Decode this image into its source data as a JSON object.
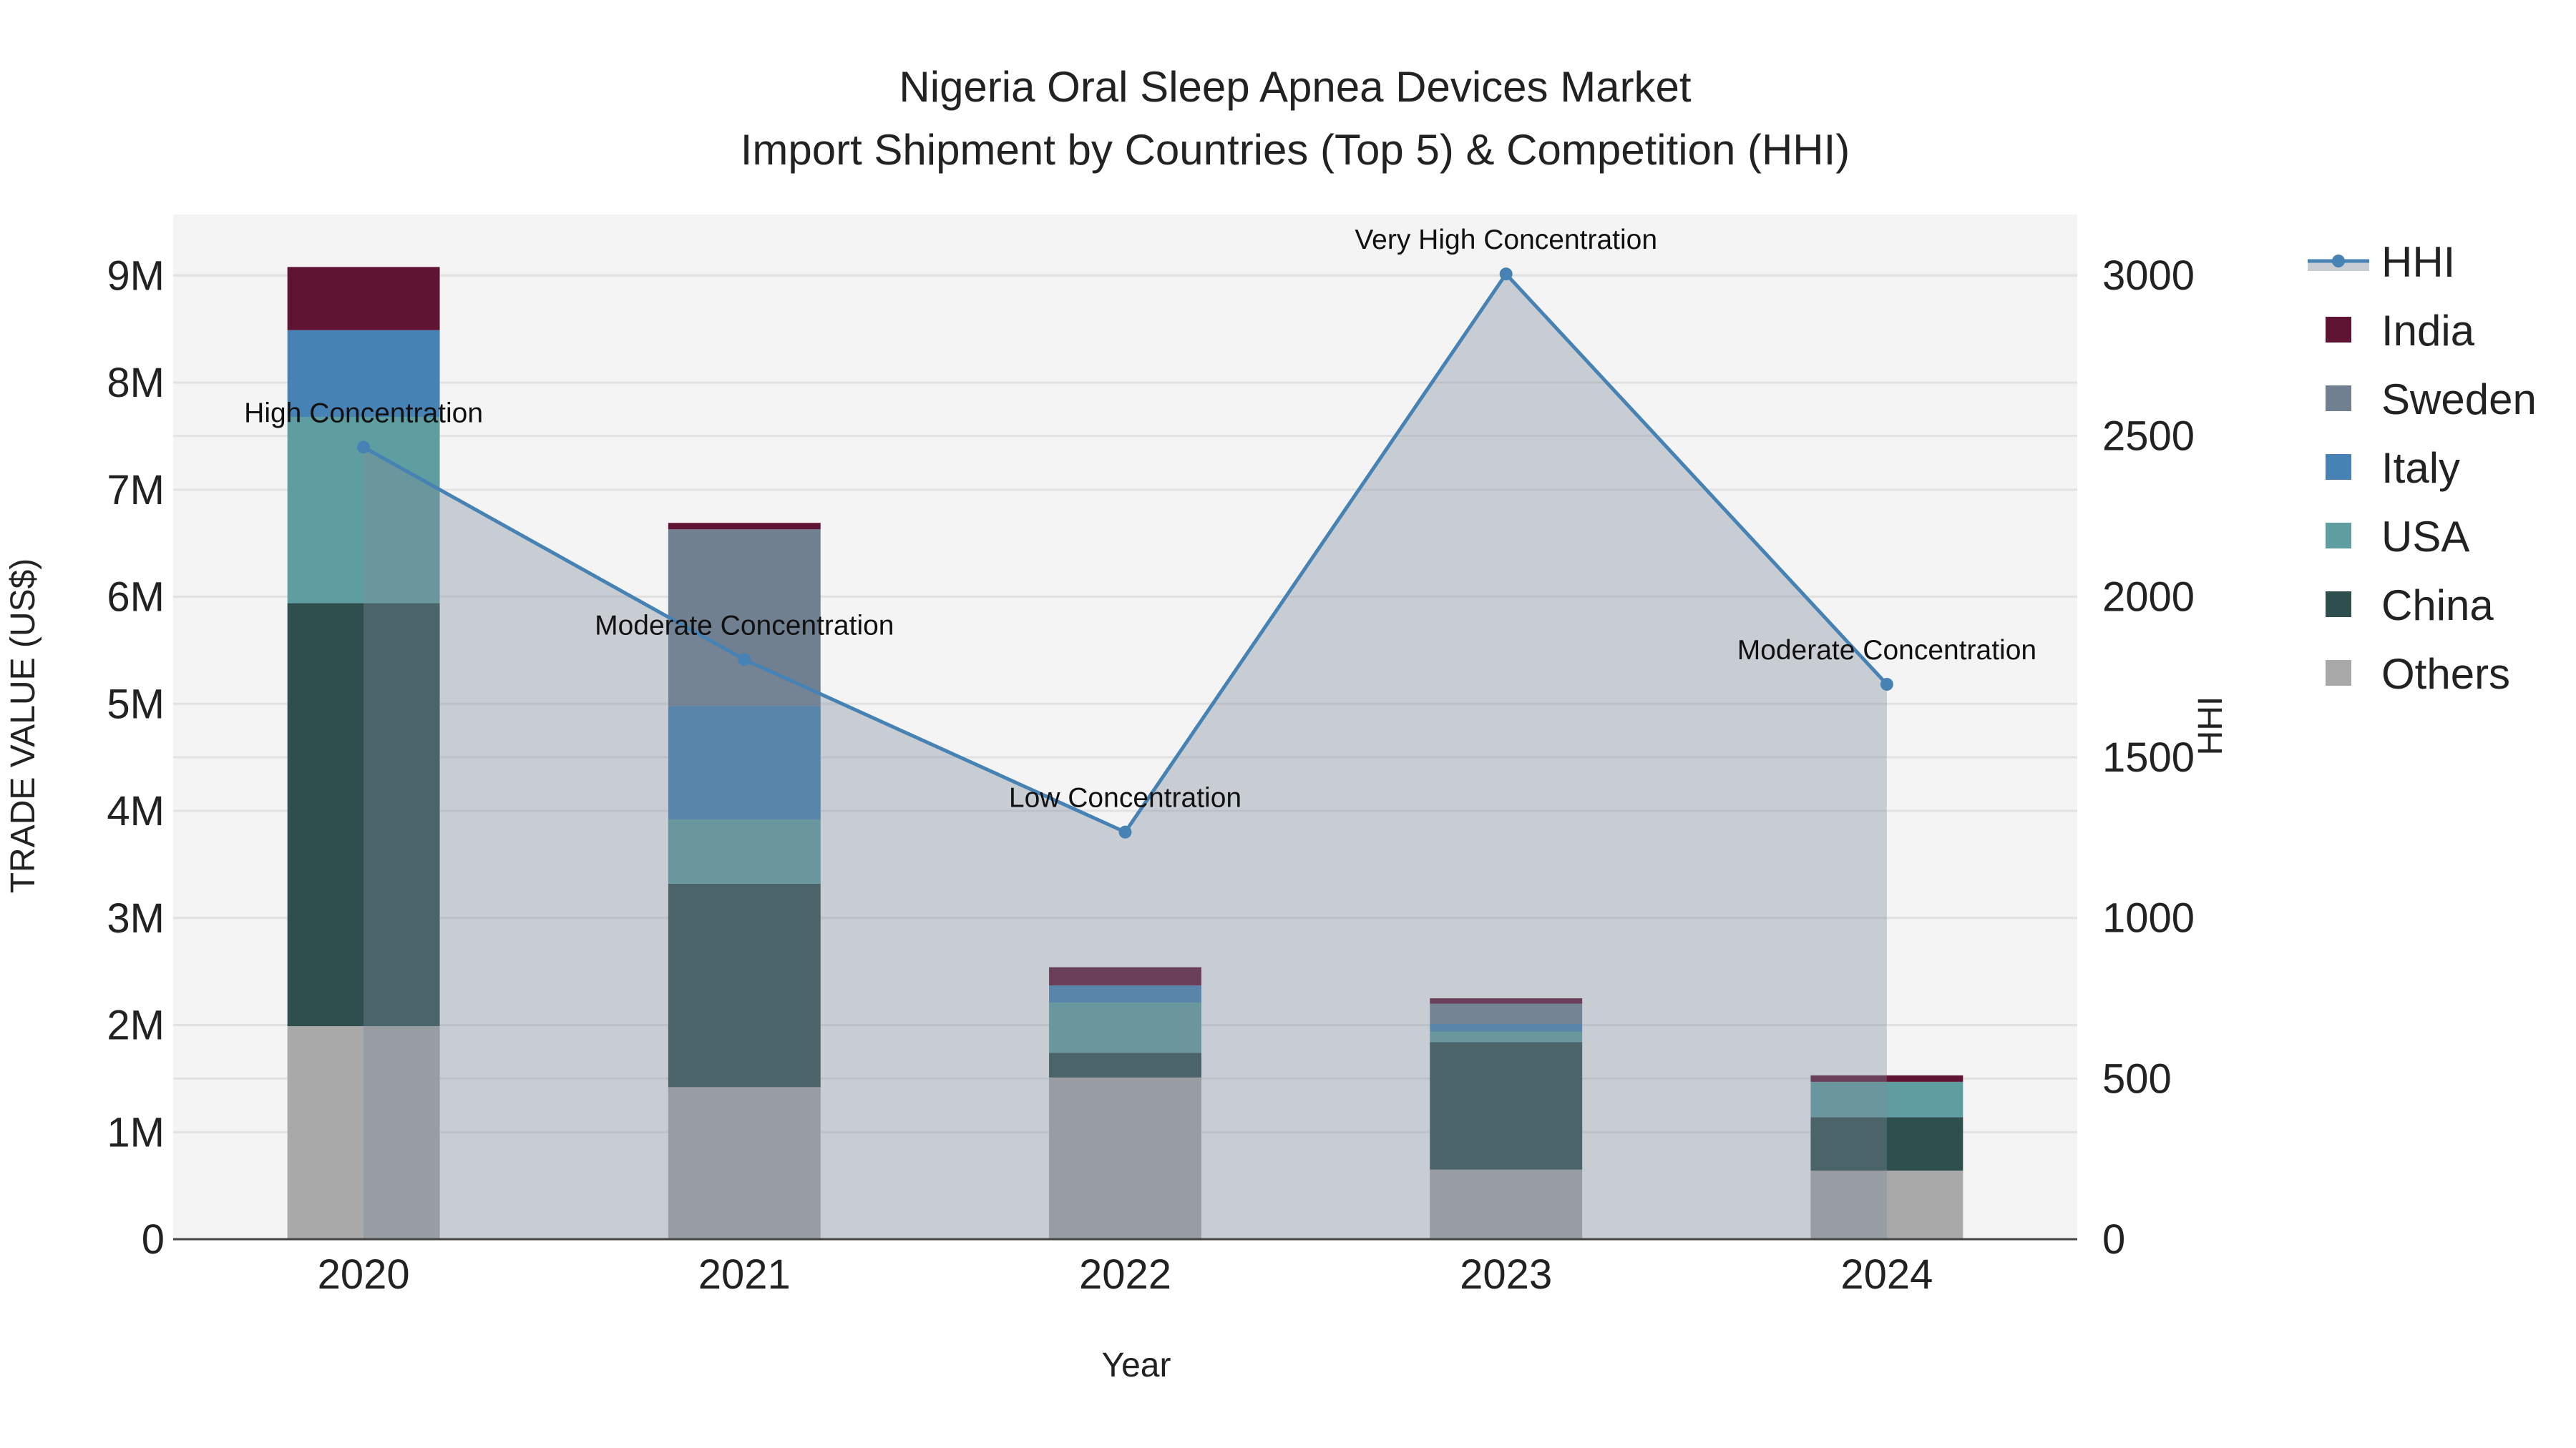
{
  "chart_data": {
    "type": "bar",
    "title": "Nigeria Oral Sleep Apnea Devices Market",
    "subtitle": "Import Shipment by Countries (Top 5) & Competition (HHI)",
    "xlabel": "Year",
    "ylabel": "TRADE VALUE (US$)",
    "y2label": "HHI",
    "categories": [
      "2020",
      "2021",
      "2022",
      "2023",
      "2024"
    ],
    "ylim": [
      0,
      9570000
    ],
    "y2lim": [
      0,
      3189
    ],
    "yticks": [
      0,
      1000000,
      2000000,
      3000000,
      4000000,
      5000000,
      6000000,
      7000000,
      8000000,
      9000000
    ],
    "yticklabels": [
      "0",
      "1M",
      "2M",
      "3M",
      "4M",
      "5M",
      "6M",
      "7M",
      "8M",
      "9M"
    ],
    "y2ticks": [
      0,
      500,
      1000,
      1500,
      2000,
      2500,
      3000
    ],
    "y2ticklabels": [
      "0",
      "500",
      "1000",
      "1500",
      "2000",
      "2500",
      "3000"
    ],
    "grid": true,
    "legend_position": "right",
    "series": [
      {
        "name": "Others",
        "color": "#a9a9a9",
        "values": [
          1990000,
          1420000,
          1510000,
          650000,
          640000
        ]
      },
      {
        "name": "China",
        "color": "#2f4f4f",
        "values": [
          3950000,
          1900000,
          230000,
          1190000,
          500000
        ]
      },
      {
        "name": "USA",
        "color": "#5f9ea0",
        "values": [
          1740000,
          600000,
          470000,
          100000,
          330000
        ]
      },
      {
        "name": "Italy",
        "color": "#4682b4",
        "values": [
          810000,
          1060000,
          160000,
          70000,
          0
        ]
      },
      {
        "name": "Sweden",
        "color": "#708090",
        "values": [
          0,
          1650000,
          0,
          190000,
          0
        ]
      },
      {
        "name": "India",
        "color": "#601434",
        "values": [
          590000,
          60000,
          170000,
          50000,
          60000
        ]
      }
    ],
    "hhi": {
      "name": "HHI",
      "color": "#4682b4",
      "values": [
        2465,
        1804,
        1267,
        3004,
        1727
      ],
      "annotations": [
        "High Concentration",
        "Moderate Concentration",
        "Low Concentration",
        "Very High Concentration",
        "Moderate Concentration"
      ]
    },
    "legend_order": [
      "HHI",
      "India",
      "Sweden",
      "Italy",
      "USA",
      "China",
      "Others"
    ]
  }
}
